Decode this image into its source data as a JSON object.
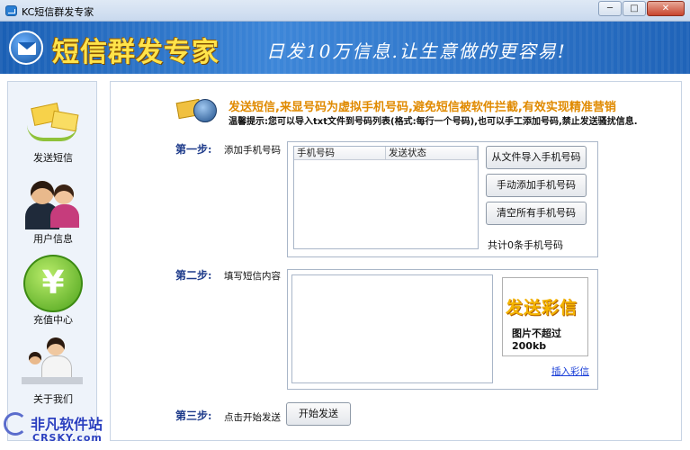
{
  "window": {
    "title": "KC短信群发专家",
    "minimize": "─",
    "maximize": "□",
    "close": "✕"
  },
  "banner": {
    "title": "短信群发专家",
    "slogan": "日发10万信息.让生意做的更容易!",
    "icon": "mail-icon"
  },
  "sidebar": {
    "items": [
      {
        "label": "发送短信",
        "icon": "send-sms-icon"
      },
      {
        "label": "用户信息",
        "icon": "users-icon"
      },
      {
        "label": "充值中心",
        "icon": "yuan-coin-icon",
        "glyph": "¥"
      },
      {
        "label": "关于我们",
        "icon": "support-staff-icon"
      }
    ]
  },
  "header": {
    "line1": "发送短信,来显号码为虚拟手机号码,避免短信被软件拦截,有效实现精准营销",
    "line2": "温馨提示:您可以导入txt文件到号码列表(格式:每行一个号码),也可以手工添加号码,禁止发送骚扰信息."
  },
  "step1": {
    "label": "第一步:",
    "desc": "添加手机号码",
    "columns": [
      "手机号码",
      "发送状态"
    ],
    "buttons": {
      "import": "从文件导入手机号码",
      "manual": "手动添加手机号码",
      "clear": "清空所有手机号码"
    },
    "count": "共计0条手机号码"
  },
  "step2": {
    "label": "第二步:",
    "desc": "填写短信内容",
    "mms_title": "发送彩信",
    "mms_sub": "图片不超过200kb",
    "insert_link": "插入彩信"
  },
  "step3": {
    "label": "第三步:",
    "desc": "点击开始发送",
    "start": "开始发送"
  },
  "watermark": {
    "cn": "非凡软件站",
    "en": "CRSKY.com"
  }
}
